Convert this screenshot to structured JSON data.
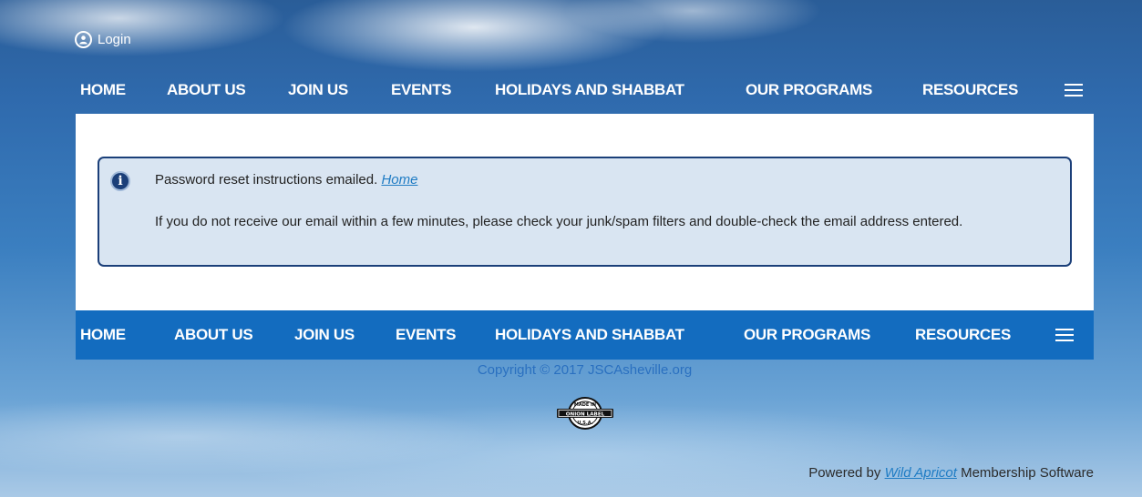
{
  "header": {
    "login_label": "Login"
  },
  "nav": {
    "items": [
      "HOME",
      "ABOUT US",
      "JOIN US",
      "EVENTS",
      "HOLIDAYS AND SHABBAT",
      "OUR PROGRAMS",
      "RESOURCES"
    ],
    "menu_icon": "hamburger-icon"
  },
  "notice": {
    "icon": "info-icon",
    "message": "Password reset instructions emailed.",
    "home_link": "Home",
    "details": "If you do not receive our email within a few minutes, please check your junk/spam filters and double-check the email address entered."
  },
  "footer": {
    "copyright": "Copyright © 2017 JSCAsheville.org",
    "badge_text_top": "MADE IN",
    "badge_text_middle": "ONION LABEL",
    "badge_text_bottom": "U.S.A.",
    "powered_prefix": "Powered by",
    "powered_link": "Wild Apricot",
    "powered_suffix": "Membership Software"
  },
  "colors": {
    "nav_bar_bottom": "#136cbf",
    "notice_border": "#1b3f79",
    "notice_background": "#d9e5f2",
    "link": "#1f7cc4"
  }
}
